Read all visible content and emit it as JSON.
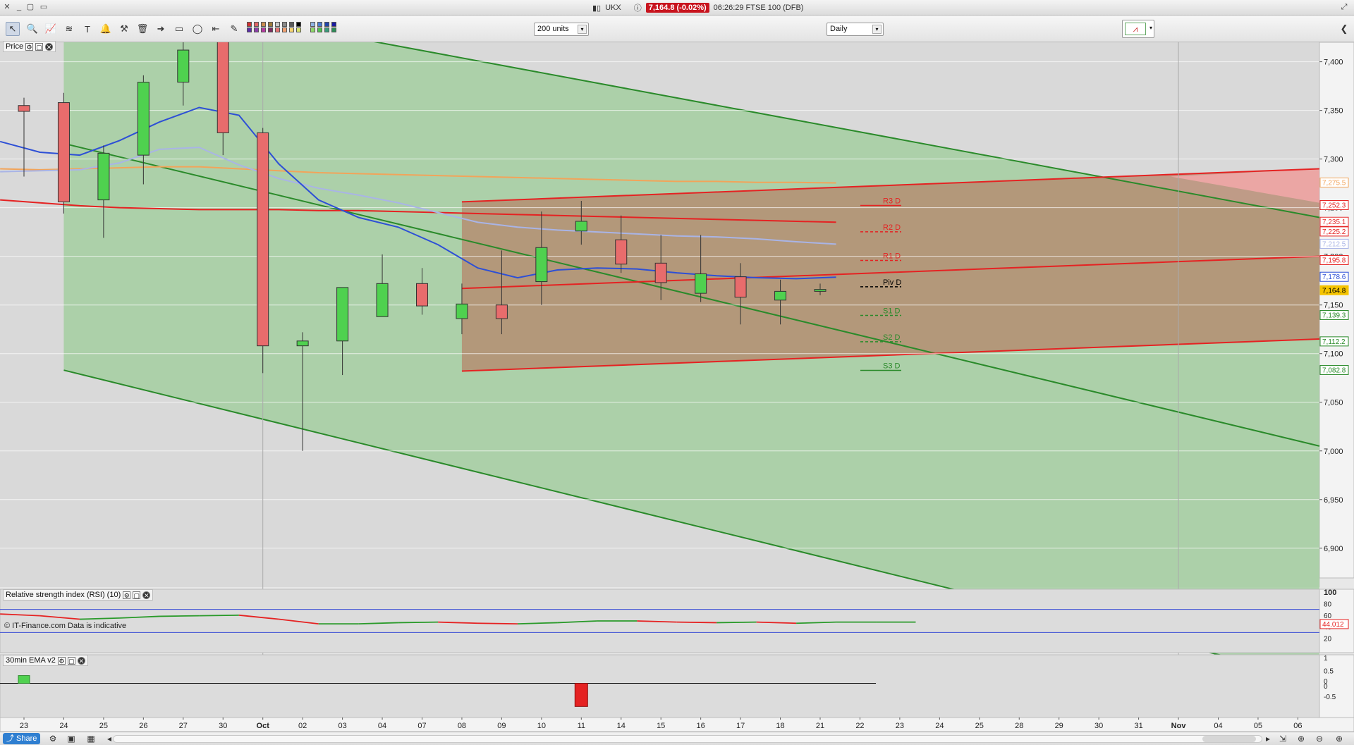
{
  "window": {
    "ticker": "UKX",
    "price_change": "7,164.8 (-0.02%)",
    "status_text": "06:26:29 FTSE 100 (DFB)"
  },
  "toolbar": {
    "units_select": "200 units",
    "period_select": "Daily",
    "tools": [
      "pointer-icon",
      "zoom-icon",
      "chart-icon",
      "rafi-icon",
      "alert-icon",
      "tools-icon",
      "trash-icon",
      "arrow-icon",
      "rectangle-icon",
      "ellipse-icon",
      "line-icon",
      "pen-icon"
    ],
    "swatches": [
      "#d32f2f",
      "#e06666",
      "#c98a4d",
      "#9e7b3a",
      "#c9c9c9",
      "#8a8a8a",
      "#5b5b5b",
      "#000000",
      "#8fb3e3",
      "#4a7bd1",
      "#2244aa",
      "#1a1aa0",
      "#5a2ea6",
      "#8b3fa8",
      "#b43aa0",
      "#7b2d5f",
      "#e57373",
      "#f0a070",
      "#f5d470",
      "#d8e36a",
      "#8fd86a",
      "#4fbf4f",
      "#3a9a7a",
      "#2e8b57"
    ]
  },
  "panes": {
    "price_label": "Price",
    "rsi_label": "Relative strength index (RSI) (10)",
    "ema_label": "30min EMA v2",
    "footnote": "© IT-Finance.com  Data is indicative"
  },
  "statusbar": {
    "share_label": "Share"
  },
  "chart_data": {
    "type": "candlestick",
    "instrument": "FTSE 100 (DFB)",
    "x_labels": [
      "23",
      "24",
      "25",
      "26",
      "27",
      "30",
      "Oct",
      "02",
      "03",
      "04",
      "07",
      "08",
      "09",
      "10",
      "11",
      "14",
      "15",
      "16",
      "17",
      "18",
      "21",
      "22",
      "23",
      "24",
      "25",
      "28",
      "29",
      "30",
      "31",
      "Nov",
      "04",
      "05",
      "06"
    ],
    "y_ticks": [
      "7,400",
      "7,350",
      "7,300",
      "7,250",
      "7,200",
      "7,150",
      "7,100",
      "7,050",
      "7,000",
      "6,950",
      "6,900"
    ],
    "ylim": [
      6860,
      7420
    ],
    "candles": [
      {
        "d": "23",
        "o": 7355,
        "h": 7363,
        "l": 7282,
        "c": 7349
      },
      {
        "d": "24",
        "o": 7358,
        "h": 7368,
        "l": 7244,
        "c": 7256
      },
      {
        "d": "25",
        "o": 7258,
        "h": 7314,
        "l": 7219,
        "c": 7306
      },
      {
        "d": "26",
        "o": 7304,
        "h": 7386,
        "l": 7274,
        "c": 7379
      },
      {
        "d": "27",
        "o": 7379,
        "h": 7424,
        "l": 7355,
        "c": 7412
      },
      {
        "d": "30",
        "o": 7438,
        "h": 7448,
        "l": 7304,
        "c": 7327
      },
      {
        "d": "Oct",
        "o": 7327,
        "h": 7332,
        "l": 7080,
        "c": 7108
      },
      {
        "d": "02",
        "o": 7108,
        "h": 7122,
        "l": 7000,
        "c": 7113
      },
      {
        "d": "03",
        "o": 7113,
        "h": 7168,
        "l": 7078,
        "c": 7168
      },
      {
        "d": "04",
        "o": 7138,
        "h": 7202,
        "l": 7155,
        "c": 7172
      },
      {
        "d": "07",
        "o": 7172,
        "h": 7188,
        "l": 7140,
        "c": 7149
      },
      {
        "d": "08",
        "o": 7136,
        "h": 7172,
        "l": 7120,
        "c": 7151
      },
      {
        "d": "09",
        "o": 7150,
        "h": 7206,
        "l": 7120,
        "c": 7136
      },
      {
        "d": "10",
        "o": 7174,
        "h": 7246,
        "l": 7150,
        "c": 7209
      },
      {
        "d": "11",
        "o": 7226,
        "h": 7257,
        "l": 7212,
        "c": 7236
      },
      {
        "d": "14",
        "o": 7217,
        "h": 7242,
        "l": 7183,
        "c": 7192
      },
      {
        "d": "15",
        "o": 7193,
        "h": 7222,
        "l": 7155,
        "c": 7173
      },
      {
        "d": "16",
        "o": 7162,
        "h": 7222,
        "l": 7153,
        "c": 7182
      },
      {
        "d": "17",
        "o": 7179,
        "h": 7193,
        "l": 7130,
        "c": 7158
      },
      {
        "d": "18",
        "o": 7155,
        "h": 7176,
        "l": 7130,
        "c": 7164
      },
      {
        "d": "21",
        "o": 7164,
        "h": 7172,
        "l": 7160,
        "c": 7166
      }
    ],
    "pivots": [
      {
        "label": "R3 D",
        "value": "7,252.3"
      },
      {
        "label": "R2 D",
        "value": "7,225.2"
      },
      {
        "label": "R1 D",
        "value": "7,195.8"
      },
      {
        "label": "Piv D",
        "value": "7,168.7"
      },
      {
        "label": "S1 D",
        "value": "7,139.3"
      },
      {
        "label": "S2 D",
        "value": "7,112.2"
      },
      {
        "label": "S3 D",
        "value": "7,082.8"
      }
    ],
    "axis_badges": [
      {
        "value": "7,275.5",
        "color": "#f2a45a"
      },
      {
        "value": "7,235.1",
        "color": "#e53030"
      },
      {
        "value": "7,212.5",
        "color": "#a9b4e6"
      },
      {
        "value": "7,178.6",
        "color": "#2d4fd6"
      },
      {
        "value": "7,164.8",
        "color": "#f5c400"
      }
    ],
    "rsi": {
      "ticks": [
        "100",
        "80",
        "60",
        "40",
        "20"
      ],
      "current": "44.012",
      "values": [
        62,
        59,
        53,
        55,
        58,
        59,
        60,
        53,
        45,
        45,
        47,
        48,
        46,
        45,
        47,
        50,
        50,
        48,
        47,
        48,
        46,
        48,
        48,
        48
      ]
    },
    "ema": {
      "ticks": [
        "1",
        "0.5",
        "0",
        "0",
        "-0.5"
      ]
    }
  }
}
